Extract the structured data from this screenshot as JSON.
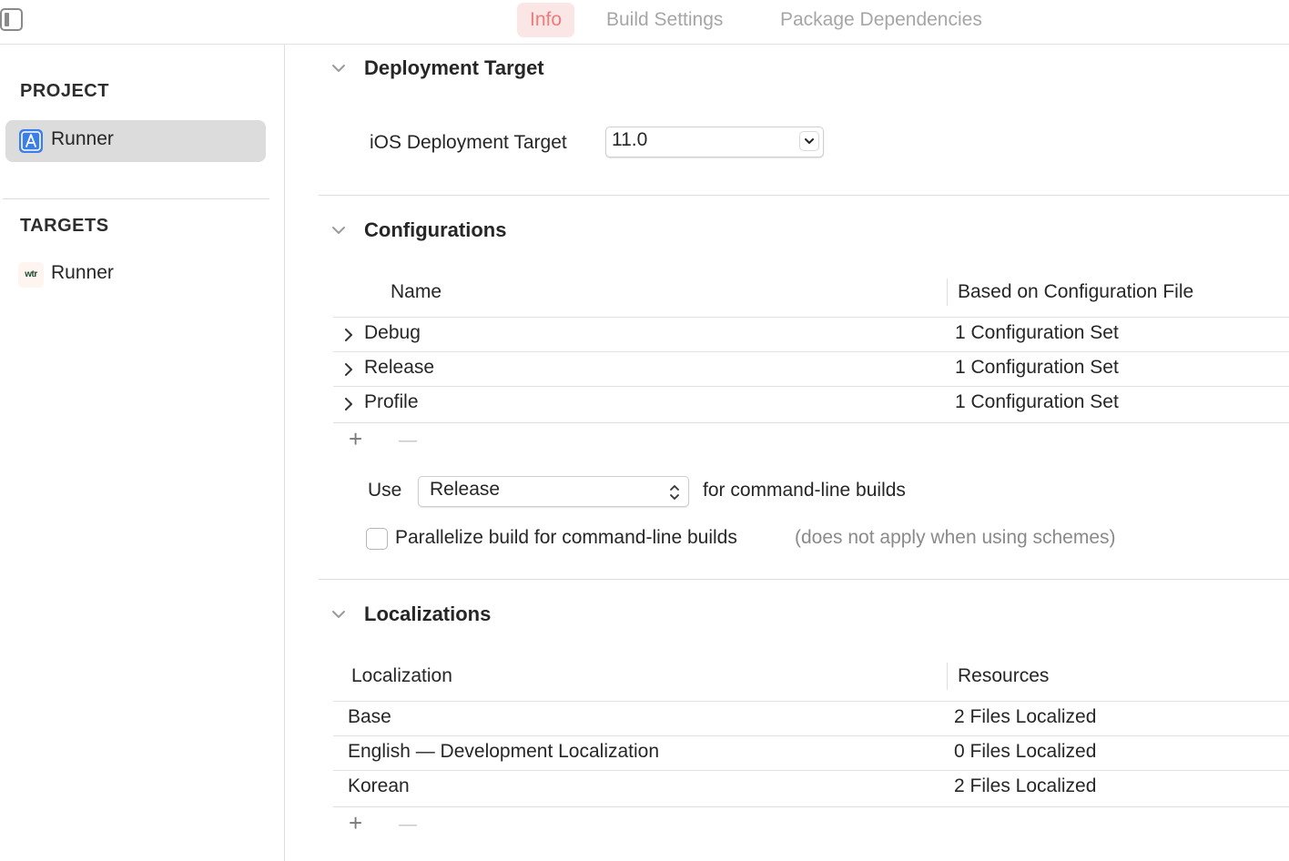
{
  "tabs": [
    {
      "label": "Info",
      "active": true
    },
    {
      "label": "Build Settings",
      "active": false
    },
    {
      "label": "Package Dependencies",
      "active": false
    }
  ],
  "sidebar": {
    "project_title": "PROJECT",
    "project_item": "Runner",
    "targets_title": "TARGETS",
    "target_item": "Runner",
    "target_icon_text": "wtr"
  },
  "deployment": {
    "heading": "Deployment Target",
    "label": "iOS Deployment Target",
    "value": "11.0"
  },
  "configurations": {
    "heading": "Configurations",
    "columns": [
      "Name",
      "Based on Configuration File"
    ],
    "rows": [
      {
        "name": "Debug",
        "file": "1 Configuration Set"
      },
      {
        "name": "Release",
        "file": "1 Configuration Set"
      },
      {
        "name": "Profile",
        "file": "1 Configuration Set"
      }
    ],
    "add": "+",
    "remove": "—",
    "use_label": "Use",
    "use_value": "Release",
    "use_suffix": "for command-line builds",
    "parallelize_label": "Parallelize build for command-line builds",
    "parallelize_note": "(does not apply when using schemes)",
    "parallelize_checked": false
  },
  "localizations": {
    "heading": "Localizations",
    "columns": [
      "Localization",
      "Resources"
    ],
    "rows": [
      {
        "name": "Base",
        "resources": "2 Files Localized"
      },
      {
        "name": "English — Development Localization",
        "resources": "0 Files Localized"
      },
      {
        "name": "Korean",
        "resources": "2 Files Localized"
      }
    ],
    "add": "+",
    "remove": "—"
  },
  "colors": {
    "accent_tab_text": "#ef7b7b",
    "accent_tab_bg": "#fbe6e6",
    "project_icon": "#3b7ee8",
    "selection": "#dcdcdc"
  }
}
